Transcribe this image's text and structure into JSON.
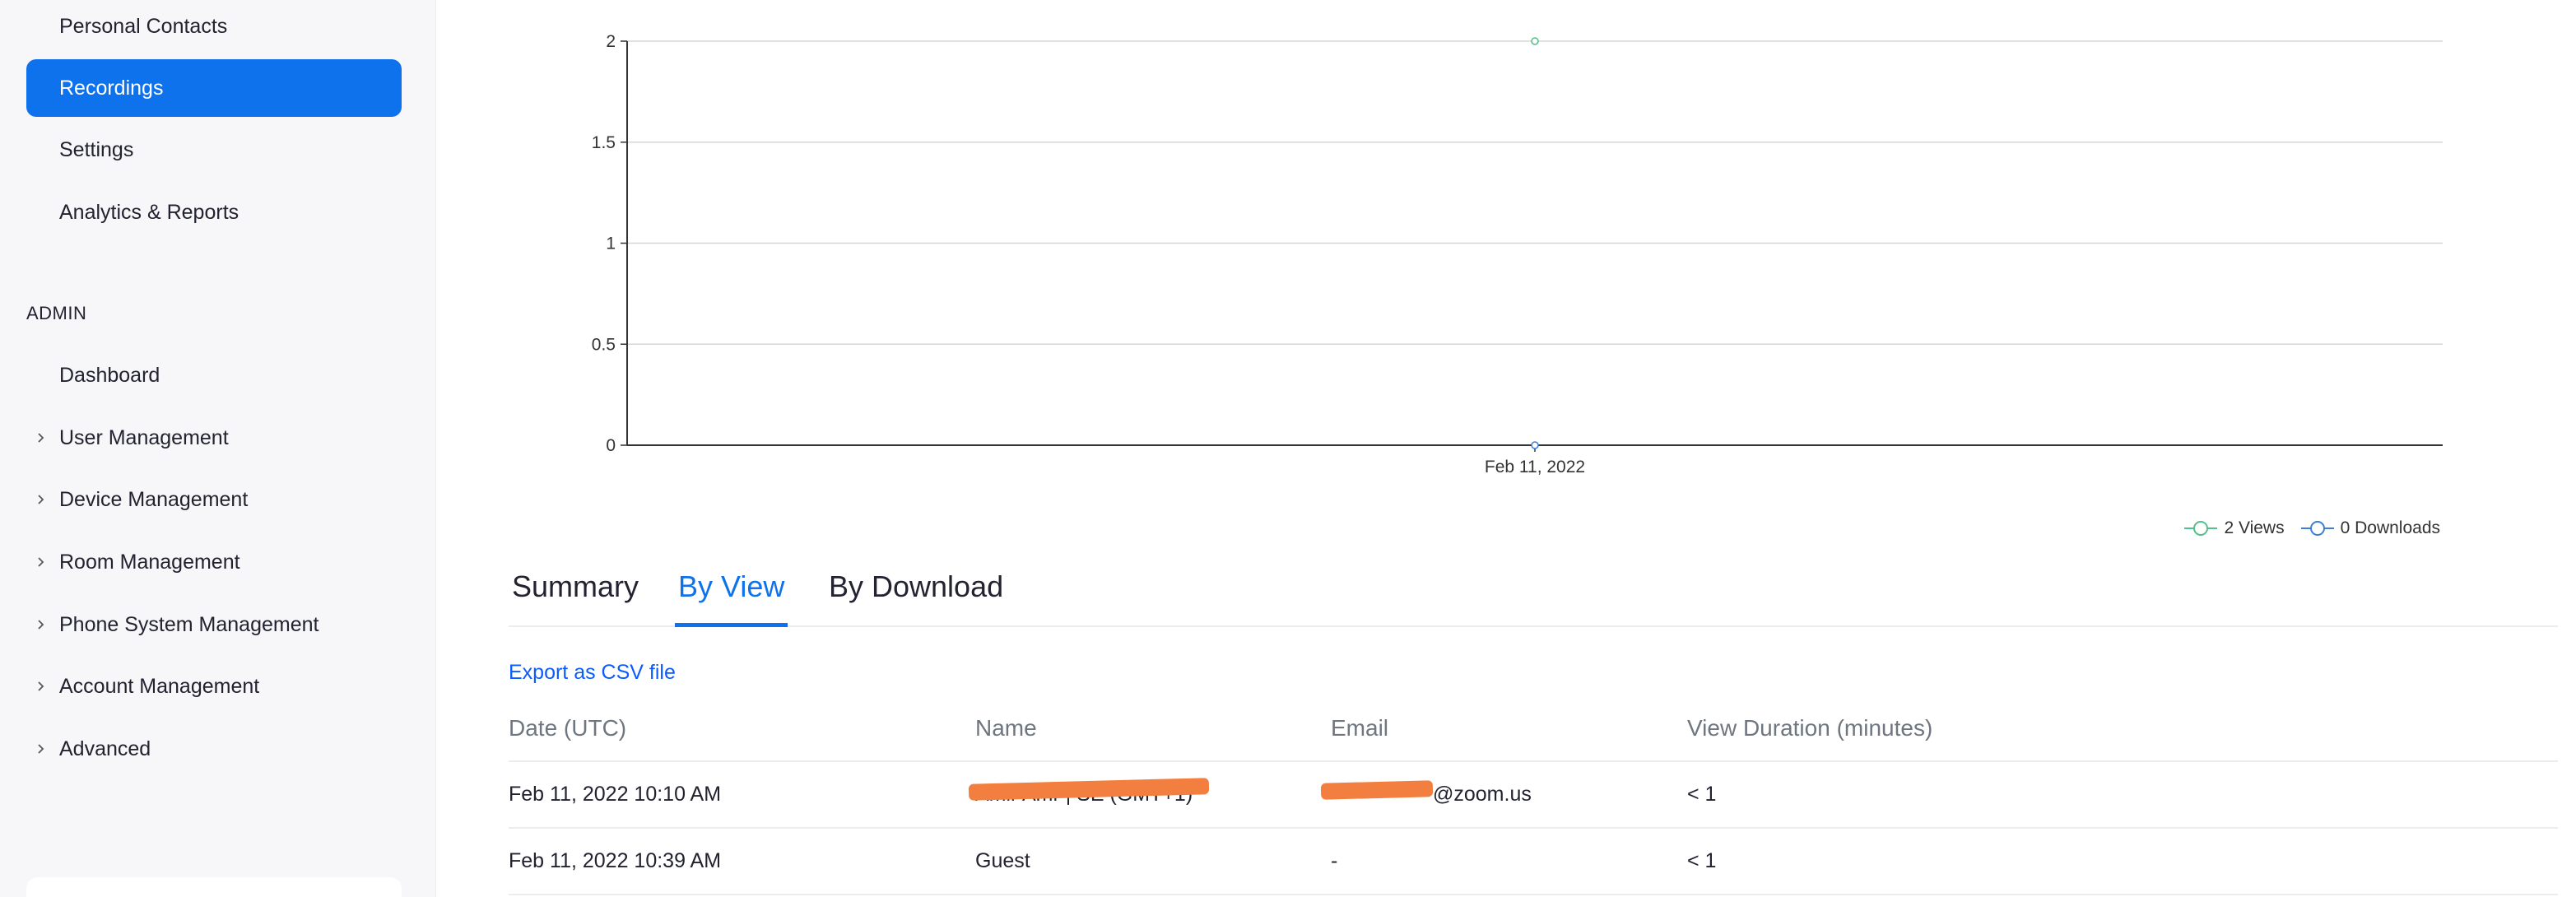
{
  "sidebar": {
    "items": [
      {
        "label": "Personal Contacts"
      },
      {
        "label": "Recordings"
      },
      {
        "label": "Settings"
      },
      {
        "label": "Analytics & Reports"
      }
    ],
    "admin_label": "ADMIN",
    "admin_items": [
      {
        "label": "Dashboard"
      },
      {
        "label": "User Management"
      },
      {
        "label": "Device Management"
      },
      {
        "label": "Room Management"
      },
      {
        "label": "Phone System Management"
      },
      {
        "label": "Account Management"
      },
      {
        "label": "Advanced"
      }
    ]
  },
  "chart_data": {
    "type": "line",
    "x": [
      "Feb 11, 2022"
    ],
    "series": [
      {
        "name": "2 Views",
        "values": [
          2
        ],
        "color": "#52c08a"
      },
      {
        "name": "0 Downloads",
        "values": [
          0
        ],
        "color": "#3b7fd6"
      }
    ],
    "yticks": [
      "0",
      "0.5",
      "1",
      "1.5",
      "2"
    ],
    "ylim": [
      0,
      2
    ],
    "grid": true,
    "legend": "bottom-right"
  },
  "tabs": [
    {
      "label": "Summary"
    },
    {
      "label": "By View"
    },
    {
      "label": "By Download"
    }
  ],
  "active_tab": "By View",
  "export_label": "Export as CSV file",
  "table": {
    "headers": [
      "Date (UTC)",
      "Name",
      "Email",
      "View Duration (minutes)"
    ],
    "rows": [
      {
        "date": "Feb 11, 2022 10:10 AM",
        "name": "Amir Amr | SE (GMT+1)",
        "email": "@zoom.us",
        "duration": "< 1"
      },
      {
        "date": "Feb 11, 2022 10:39 AM",
        "name": "Guest",
        "email": "-",
        "duration": "< 1"
      }
    ]
  },
  "colors": {
    "accent": "#0e72ed",
    "link": "#0b5cff",
    "views": "#52c08a",
    "downloads": "#3b7fd6",
    "redaction": "#f27f3f"
  }
}
